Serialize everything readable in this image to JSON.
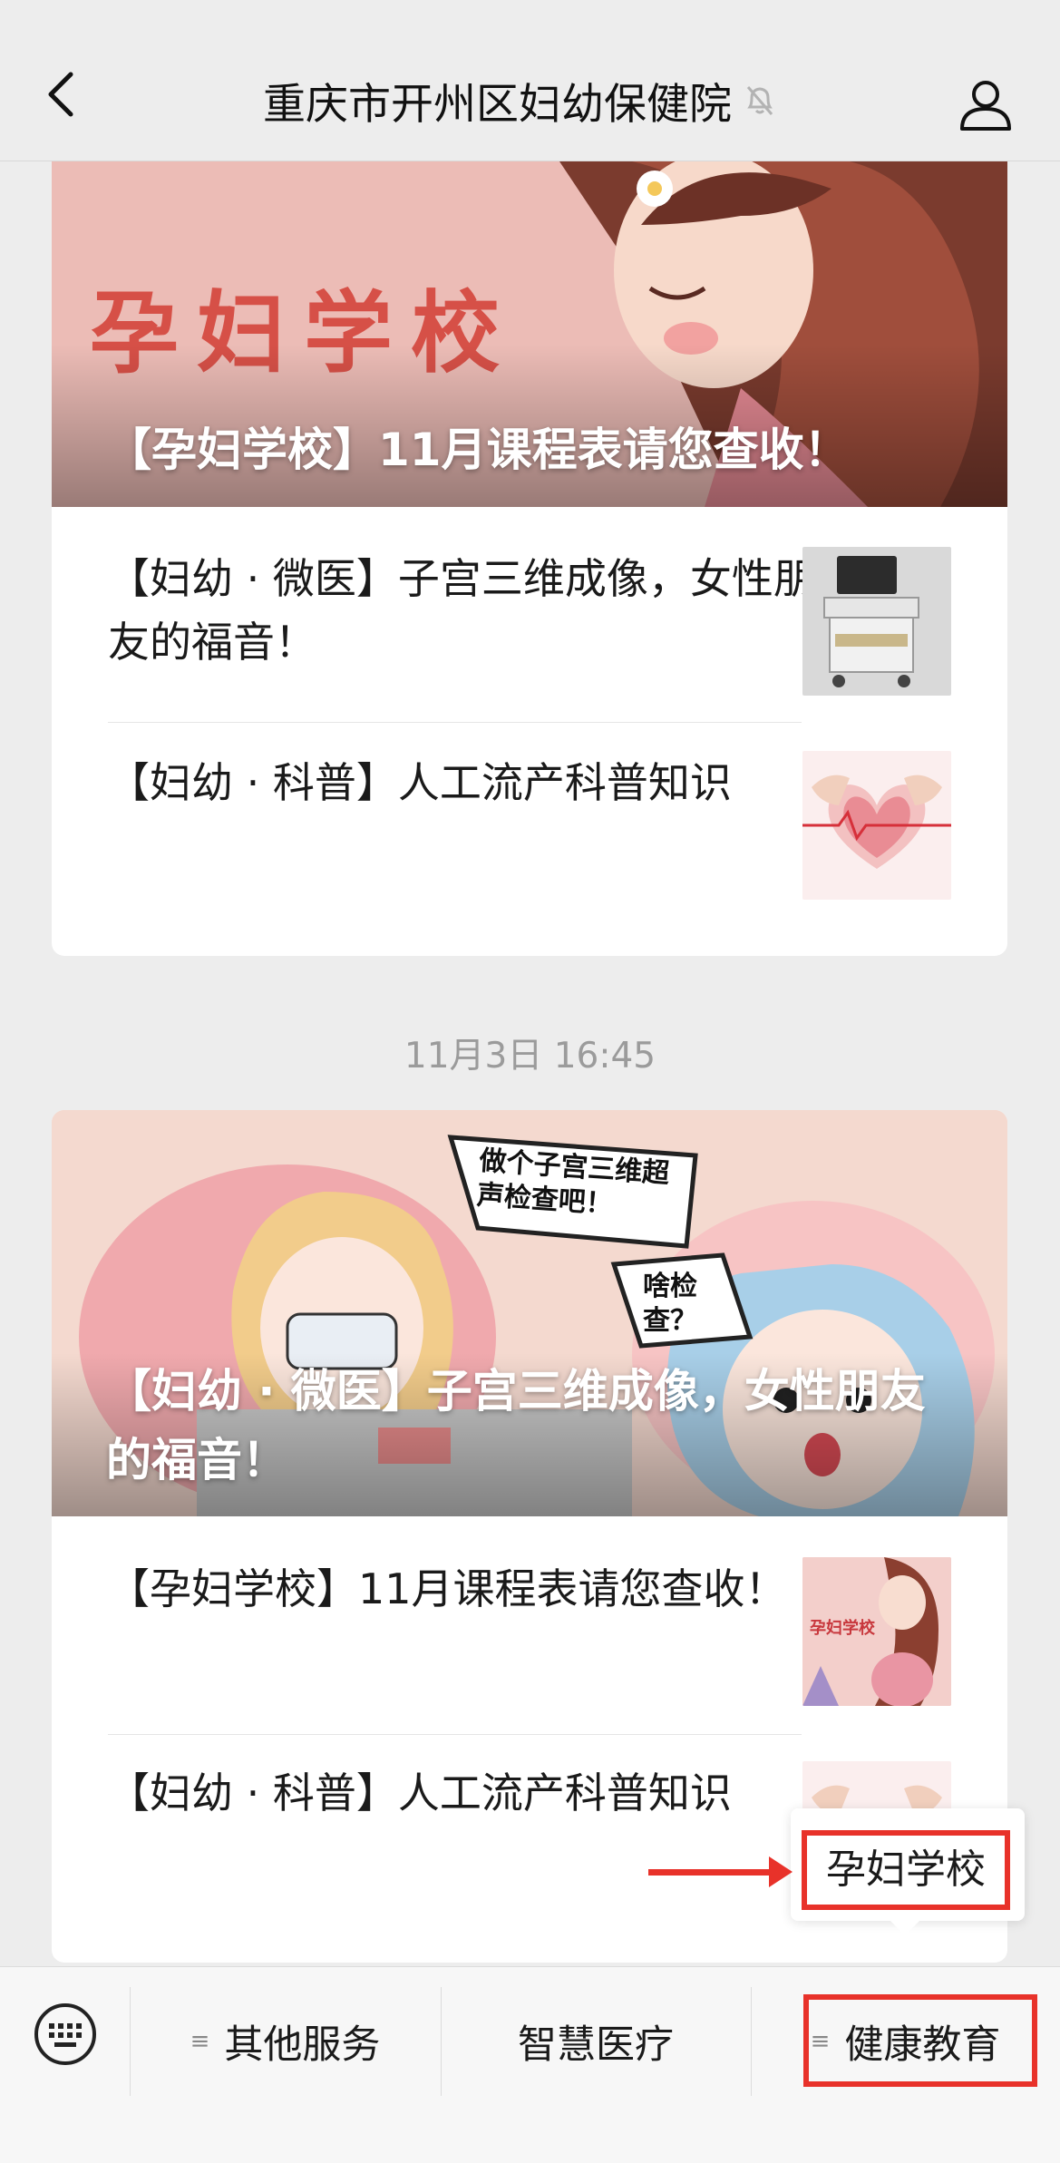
{
  "header": {
    "title": "重庆市开州区妇幼保健院",
    "back_icon": "chevron-left-icon",
    "mute_icon": "bell-off-icon",
    "profile_icon": "user-icon"
  },
  "card1": {
    "cover_big_text": "孕妇学校",
    "cover_title": "【孕妇学校】11月课程表请您查收！",
    "items": [
      {
        "title": "【妇幼 · 微医】子宫三维成像，女性朋友的福音！"
      },
      {
        "title": "【妇幼 · 科普】人工流产科普知识"
      }
    ]
  },
  "timestamp": "11月3日 16:45",
  "card2": {
    "cover_title": "【妇幼 · 微医】子宫三维成像，女性朋友的福音！",
    "bubble1": "做个子宫三维超声检查吧！",
    "bubble2": "啥检查？",
    "items": [
      {
        "title": "【孕妇学校】11月课程表请您查收！",
        "thumb_text": "孕妇学校"
      },
      {
        "title": "【妇幼 · 科普】人工流产科普知识"
      }
    ]
  },
  "popup_menu": {
    "item": "孕妇学校"
  },
  "bottom_bar": {
    "keyboard_icon": "keyboard-icon",
    "menus": [
      "其他服务",
      "智慧医疗",
      "健康教育"
    ]
  },
  "colors": {
    "highlight": "#e8322a",
    "background": "#ededed"
  }
}
